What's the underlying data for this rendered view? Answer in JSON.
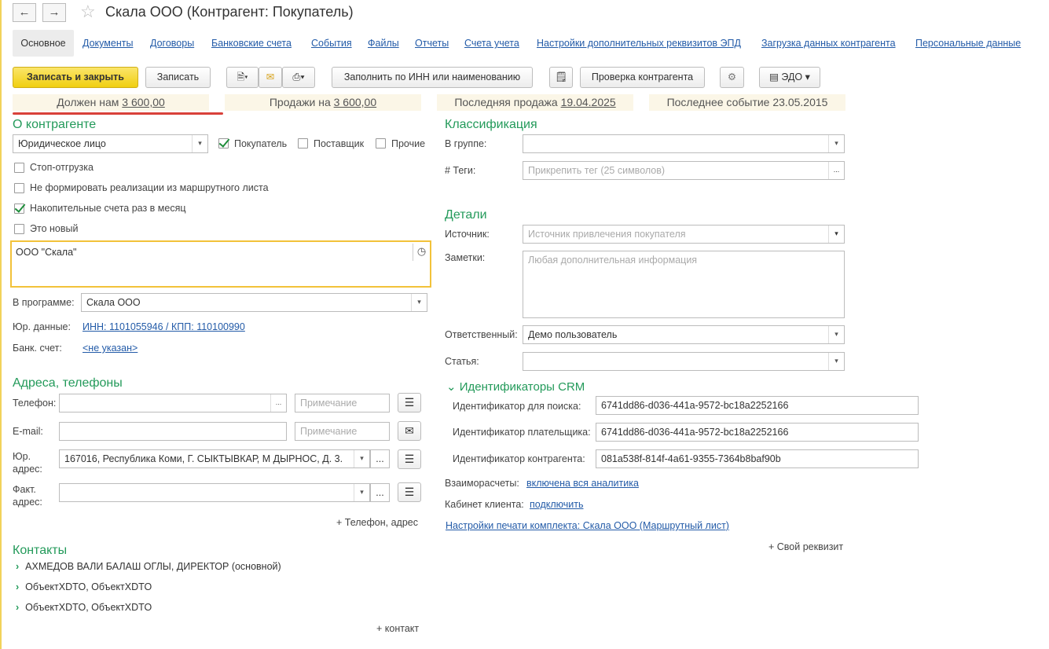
{
  "window": {
    "title": "Скала ООО (Контрагент: Покупатель)",
    "back_icon": "←",
    "forward_icon": "→",
    "star_icon": "☆"
  },
  "tabs": [
    "Основное",
    "Документы",
    "Договоры",
    "Банковские счета",
    "События",
    "Файлы",
    "Отчеты",
    "Счета учета",
    "Настройки дополнительных реквизитов ЭПД",
    "Загрузка данных контрагента",
    "Персональные данные"
  ],
  "toolbar": {
    "save_close": "Записать и закрыть",
    "save": "Записать",
    "fill_by_inn": "Заполнить по ИНН или наименованию",
    "check_contractor": "Проверка контрагента",
    "edo": "ЭДО"
  },
  "stats": {
    "owes_label": "Должен нам",
    "owes_value": "3 600,00",
    "sales_label": "Продажи на",
    "sales_value": "3 600,00",
    "last_sale_label": "Последняя продажа",
    "last_sale_value": "19.04.2025",
    "last_event": "Последнее событие 23.05.2015"
  },
  "about": {
    "heading": "О контрагенте",
    "entity_type": "Юридическое лицо",
    "buyer": "Покупатель",
    "supplier": "Поставщик",
    "other": "Прочие",
    "stop_shipment": "Стоп-отгрузка",
    "no_route_sales": "Не формировать реализации из маршрутного листа",
    "monthly_invoices": "Накопительные счета раз в месяц",
    "is_new": "Это новый",
    "full_name": "ООО \"Скала\"",
    "program_label": "В программе:",
    "program_value": "Скала ООО",
    "legal_label": "Юр. данные:",
    "legal_value": "ИНН: 1101055946 / КПП: 110100990",
    "bank_label": "Банк. счет:",
    "bank_value": "<не указан>"
  },
  "addresses": {
    "heading": "Адреса, телефоны",
    "phone_label": "Телефон:",
    "email_label": "E-mail:",
    "legal_addr_label1": "Юр.",
    "legal_addr_label2": "адрес:",
    "legal_addr_value": "167016, Республика Коми, Г. СЫКТЫВКАР, М ДЫРНОС, Д. 3.",
    "fact_addr_label1": "Факт.",
    "fact_addr_label2": "адрес:",
    "note_placeholder": "Примечание",
    "add_phone": "+ Телефон, адрес"
  },
  "contacts": {
    "heading": "Контакты",
    "items": [
      "АХМЕДОВ ВАЛИ БАЛАШ ОГЛЫ, ДИРЕКТОР (основной)",
      "ОбъектXDTO, ОбъектXDTO",
      "ОбъектXDTO, ОбъектXDTO"
    ],
    "add": "+ контакт"
  },
  "classification": {
    "heading": "Классификация",
    "group_label": "В группе:",
    "tags_label": "#  Теги:",
    "tags_placeholder": "Прикрепить тег (25 символов)"
  },
  "details": {
    "heading": "Детали",
    "source_label": "Источник:",
    "source_placeholder": "Источник привлечения покупателя",
    "notes_label": "Заметки:",
    "notes_placeholder": "Любая дополнительная информация",
    "responsible_label": "Ответственный:",
    "responsible_value": "Демо пользователь",
    "article_label": "Статья:"
  },
  "crm": {
    "heading": "Идентификаторы CRM",
    "search_label": "Идентификатор для поиска:",
    "search_value": "6741dd86-d036-441a-9572-bc18a2252166",
    "payer_label": "Идентификатор плательщика:",
    "payer_value": "6741dd86-d036-441a-9572-bc18a2252166",
    "contractor_label": "Идентификатор контрагента:",
    "contractor_value": "081a538f-814f-4a61-9355-7364b8baf90b"
  },
  "misc": {
    "settlements_label": "Взаиморасчеты:",
    "settlements_value": "включена вся аналитика",
    "cabinet_label": "Кабинет клиента:",
    "cabinet_value": "подключить",
    "print_settings": "Настройки печати комплекта: Скала ООО (Маршрутный лист)",
    "own_attr": "+ Свой реквизит"
  },
  "colors": {
    "accent": "#239a5a",
    "link": "#235ba8",
    "primary_button": "#f0cf10",
    "underline_red": "#d9413a"
  }
}
